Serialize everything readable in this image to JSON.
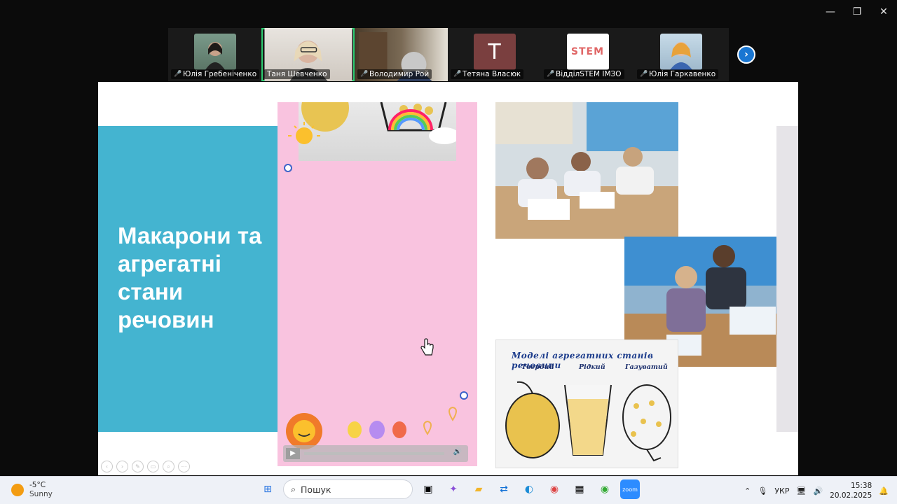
{
  "window": {
    "minimize": "—",
    "restore": "❐",
    "close": "✕"
  },
  "participants": [
    {
      "name": "Юлія Гребеніченко",
      "muted": true,
      "avatar": "photo"
    },
    {
      "name": "Таня Шевченко",
      "muted": false,
      "avatar": "photo",
      "active": true
    },
    {
      "name": "Володимир Рой",
      "muted": true,
      "avatar": "photo"
    },
    {
      "name": "Тетяна Власюк",
      "muted": true,
      "avatar": "letter",
      "letter": "T"
    },
    {
      "name": "ВідділSTEM ІМЗО",
      "muted": true,
      "avatar": "logo",
      "logo_text": "STEM"
    },
    {
      "name": "Юлія Гаркавенко",
      "muted": true,
      "avatar": "photo"
    }
  ],
  "slide": {
    "title": "Макарони та агрегатні стани речовин",
    "caption": "Моделі агрегатних станів речовини",
    "labels": [
      "Твердий",
      "Рідкий",
      "Газуватий"
    ]
  },
  "colors": {
    "teal": "#44b4d0",
    "pink": "#f9c3df",
    "active_outline": "#2ecc71",
    "next_button": "#1976d2"
  },
  "taskbar": {
    "weather_temp": "-5°C",
    "weather_desc": "Sunny",
    "search_placeholder": "Пошук",
    "language": "УКР",
    "time": "15:38",
    "date": "20.02.2025",
    "pinned_icons": [
      "windows-start-icon",
      "task-view-icon",
      "copilot-icon",
      "file-explorer-icon",
      "teamviewer-icon",
      "edge-icon",
      "chrome-icon",
      "calendar-app-icon",
      "chrome-profile-icon",
      "zoom-icon"
    ]
  }
}
